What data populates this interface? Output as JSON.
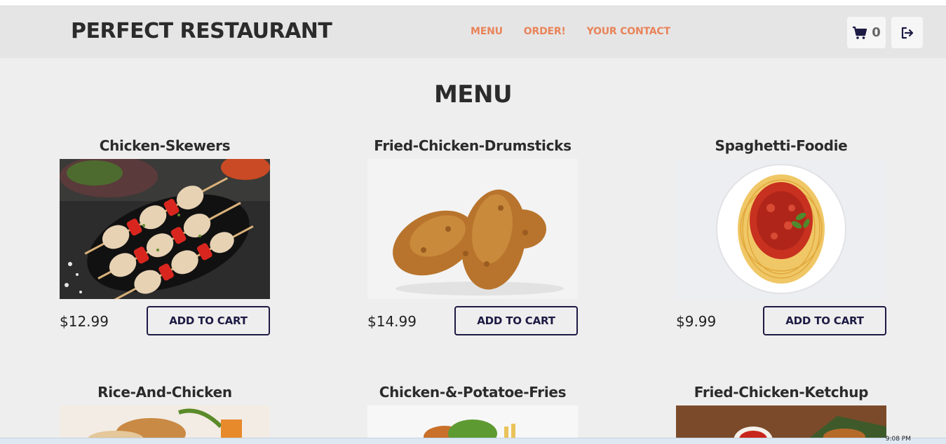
{
  "header": {
    "brand": "PERFECT RESTAURANT",
    "nav": [
      "MENU",
      "ORDER!",
      "YOUR CONTACT"
    ],
    "cart_count": "0"
  },
  "menu": {
    "title": "MENU",
    "items": [
      {
        "name": "Chicken-Skewers",
        "price": "$12.99",
        "button": "ADD TO CART"
      },
      {
        "name": "Fried-Chicken-Drumsticks",
        "price": "$14.99",
        "button": "ADD TO CART"
      },
      {
        "name": "Spaghetti-Foodie",
        "price": "$9.99",
        "button": "ADD TO CART"
      },
      {
        "name": "Rice-And-Chicken"
      },
      {
        "name": "Chicken-&-Potatoe-Fries"
      },
      {
        "name": "Fried-Chicken-Ketchup"
      }
    ]
  },
  "taskbar": {
    "clock": "9:08 PM"
  },
  "colors": {
    "accent_nav": "#e8845a",
    "button_border": "#1d1b44",
    "header_bg": "#e6e5e5",
    "page_bg": "#efeeee"
  }
}
